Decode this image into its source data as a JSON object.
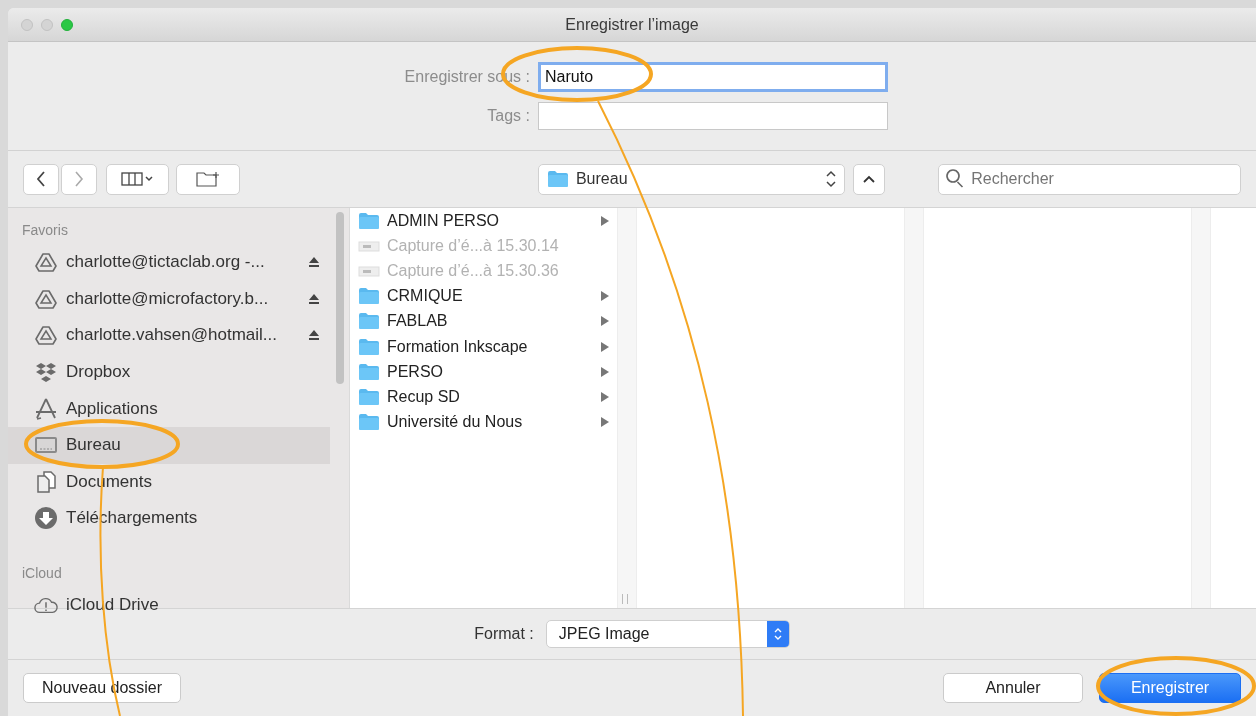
{
  "window": {
    "title": "Enregistrer l’image"
  },
  "save_as": {
    "label": "Enregistrer sous :",
    "value": "Naruto"
  },
  "tags": {
    "label": "Tags :"
  },
  "location": {
    "value": "Bureau"
  },
  "search": {
    "placeholder": "Rechercher"
  },
  "sidebar": {
    "sections": [
      {
        "title": "Favoris",
        "items": [
          {
            "kind": "drive",
            "label": "charlotte@tictaclab.org -...",
            "eject": true,
            "selected": false
          },
          {
            "kind": "drive",
            "label": "charlotte@microfactory.b...",
            "eject": true,
            "selected": false
          },
          {
            "kind": "drive",
            "label": "charlotte.vahsen@hotmail...",
            "eject": true,
            "selected": false
          },
          {
            "kind": "dropbox",
            "label": "Dropbox",
            "eject": false,
            "selected": false
          },
          {
            "kind": "apps",
            "label": "Applications",
            "eject": false,
            "selected": false
          },
          {
            "kind": "desktop",
            "label": "Bureau",
            "eject": false,
            "selected": true
          },
          {
            "kind": "documents",
            "label": "Documents",
            "eject": false,
            "selected": false
          },
          {
            "kind": "downloads",
            "label": "Téléchargements",
            "eject": false,
            "selected": false
          }
        ]
      },
      {
        "title": "iCloud",
        "items": [
          {
            "kind": "cloud",
            "label": "iCloud Drive",
            "eject": false,
            "selected": false
          }
        ]
      }
    ]
  },
  "files": [
    {
      "kind": "folder",
      "name": "ADMIN PERSO",
      "disabled": false
    },
    {
      "kind": "image",
      "name": "Capture d’é...à 15.30.14",
      "disabled": true
    },
    {
      "kind": "image",
      "name": "Capture d’é...à 15.30.36",
      "disabled": true
    },
    {
      "kind": "folder",
      "name": "CRMIQUE",
      "disabled": false
    },
    {
      "kind": "folder",
      "name": "FABLAB",
      "disabled": false
    },
    {
      "kind": "folder",
      "name": "Formation Inkscape",
      "disabled": false
    },
    {
      "kind": "folder",
      "name": "PERSO",
      "disabled": false
    },
    {
      "kind": "folder",
      "name": "Recup SD",
      "disabled": false
    },
    {
      "kind": "folder",
      "name": "Université du Nous",
      "disabled": false
    }
  ],
  "format": {
    "label": "Format :",
    "value": "JPEG Image"
  },
  "buttons": {
    "new_folder": "Nouveau dossier",
    "cancel": "Annuler",
    "save": "Enregistrer"
  }
}
